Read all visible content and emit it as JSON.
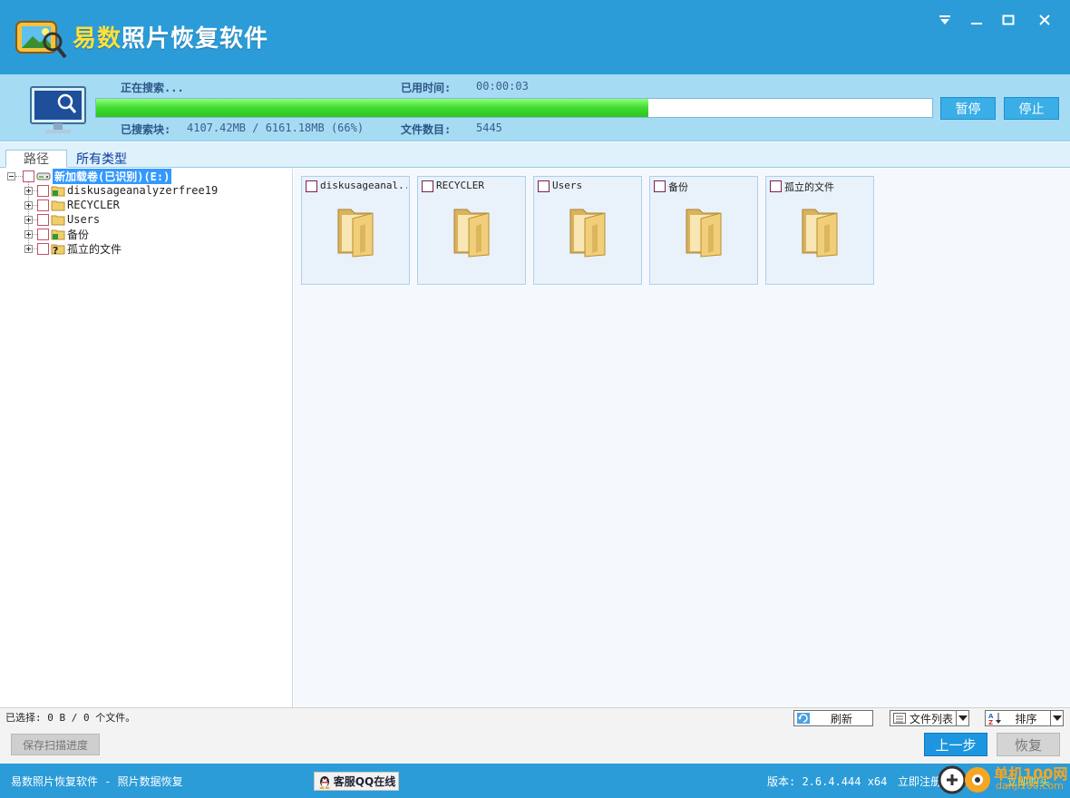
{
  "window": {
    "title_part1": "易数",
    "title_part2": "照片恢复软件"
  },
  "progress": {
    "searching_label": "正在搜索...",
    "elapsed_label": "已用时间:",
    "elapsed_value": "00:00:03",
    "searched_label": "已搜索块:",
    "searched_value": "4107.42MB / 6161.18MB (66%)",
    "files_label": "文件数目:",
    "files_value": "5445",
    "percent": 0.66,
    "pause_label": "暂停",
    "stop_label": "停止"
  },
  "tabs": [
    {
      "label": "路径",
      "active": true
    },
    {
      "label": "所有类型",
      "active": false
    }
  ],
  "tree": {
    "root": "新加载卷(已识别)(E:)",
    "children": [
      {
        "label": "diskusageanalyzerfree19",
        "icon": "folder-recycle-icon"
      },
      {
        "label": "RECYCLER",
        "icon": "folder-icon"
      },
      {
        "label": "Users",
        "icon": "folder-icon"
      },
      {
        "label": "备份",
        "icon": "folder-recycle-icon"
      },
      {
        "label": "孤立的文件",
        "icon": "folder-question-icon"
      }
    ]
  },
  "tiles": [
    {
      "label": "diskusageanal..."
    },
    {
      "label": "RECYCLER"
    },
    {
      "label": "Users"
    },
    {
      "label": "备份"
    },
    {
      "label": "孤立的文件"
    }
  ],
  "bottom": {
    "selection_info": "已选择: 0 B / 0 个文件。",
    "save_progress_label": "保存扫描进度",
    "refresh_label": "刷新",
    "file_list_label": "文件列表",
    "sort_label": "排序",
    "prev_label": "上一步",
    "recover_label": "恢复"
  },
  "status": {
    "left": "易数照片恢复软件 - 照片数据恢复",
    "qq_label": "客服QQ在线",
    "version": "版本: 2.6.4.444 x64",
    "register": "立即注册",
    "buy": "立即购买",
    "watermark_line1": "单机100网",
    "watermark_line2": "danji100.com"
  },
  "colors": {
    "accent": "#2b9cd8",
    "progress_green": "#3fdb2f",
    "header_bg": "#a6dbf4"
  }
}
